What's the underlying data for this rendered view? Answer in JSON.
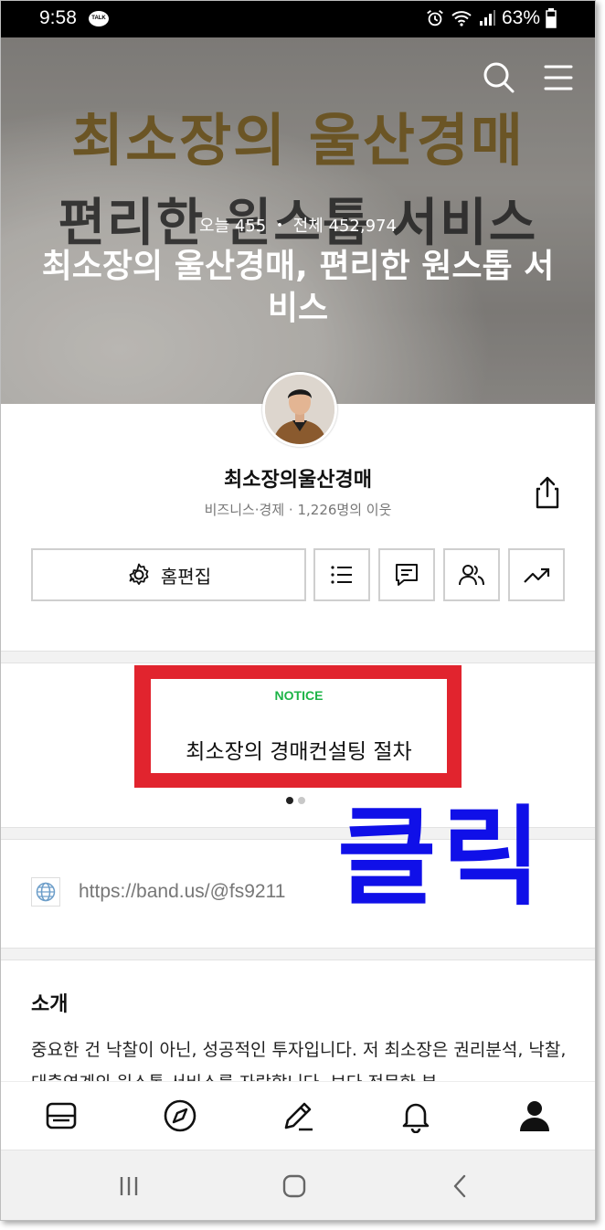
{
  "status_bar": {
    "time": "9:58",
    "talk_badge": "TALK",
    "battery": "63%"
  },
  "hero": {
    "banner_line1": "최소장의 울산경매",
    "banner_line2": "편리한 원스톱 서비스",
    "stats": "오늘 455 ・ 전체 452,974",
    "title": "최소장의 울산경매, 편리한 원스톱 서비스"
  },
  "profile": {
    "name": "최소장의울산경매",
    "meta": "비즈니스·경제 · 1,226명의 이웃"
  },
  "buttons": {
    "home_edit": "홈편집"
  },
  "notice": {
    "label": "NOTICE",
    "title": "최소장의 경매컨설팅 절차"
  },
  "annotation": {
    "click": "클릭"
  },
  "link": {
    "url": "https://band.us/@fs9211"
  },
  "intro": {
    "heading": "소개",
    "body": "중요한 건 낙찰이 아닌, 성공적인 투자입니다. 저 최소장은 권리분석, 낙찰, 대출연계의 원스톱 서비스를 자랑합니다. 보다 전문한 부"
  }
}
